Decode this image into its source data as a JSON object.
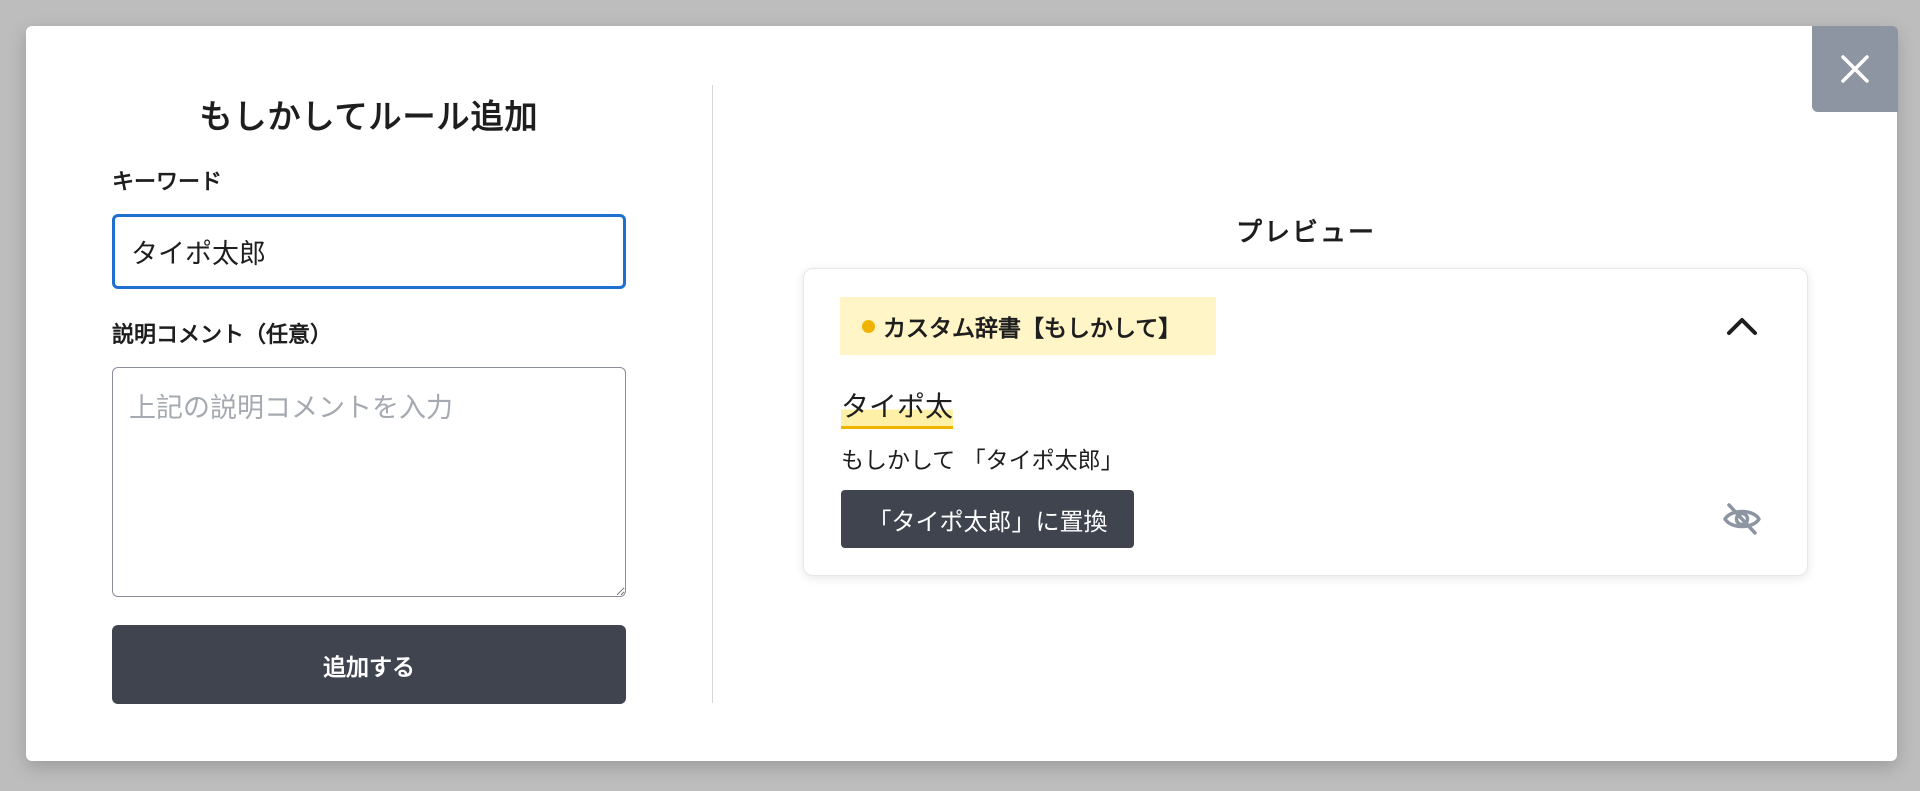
{
  "dialog": {
    "title": "もしかしてルール追加",
    "keyword_label": "キーワード",
    "keyword_value": "タイポ太郎",
    "comment_label": "説明コメント（任意）",
    "comment_placeholder": "上記の説明コメントを入力",
    "comment_value": "",
    "submit_label": "追加する"
  },
  "preview": {
    "title": "プレビュー",
    "tag_label": "カスタム辞書【もしかして】",
    "typo_text": "タイポ太",
    "suggestion_text": "もしかして 「タイポ太郎」",
    "replace_label": "「タイポ太郎」に置換"
  },
  "icons": {
    "close": "close-icon",
    "collapse": "chevron-up-icon",
    "hide": "eye-off-icon"
  },
  "colors": {
    "accent_border": "#1f6fd1",
    "button_dark": "#40444f",
    "tag_background": "#fff5c7",
    "tag_dot": "#f0b400",
    "close_background": "#8d94a2"
  }
}
